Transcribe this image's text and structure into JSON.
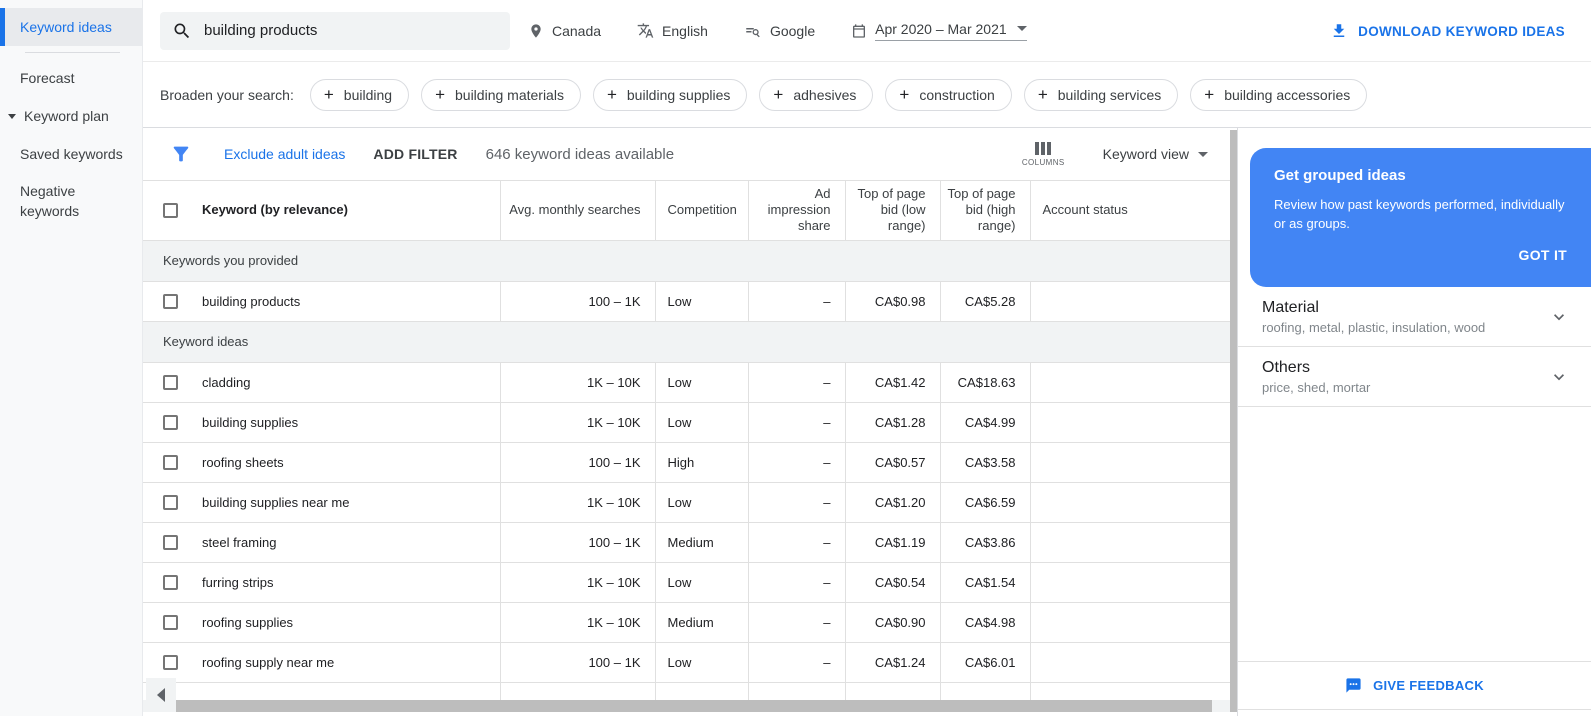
{
  "colors": {
    "accent_blue": "#1a73e8",
    "tooltip_blue": "#4285f4",
    "active_sidebar_bg": "#e8eaed",
    "section_row_bg": "#f1f3f4",
    "scrollbar_thumb": "#bdbdbd",
    "border": "#e0e0e0",
    "text_dark": "#202124",
    "text_gray": "#5f6368"
  },
  "sidebar": {
    "items": [
      {
        "label": "Keyword ideas"
      },
      {
        "label": "Forecast"
      },
      {
        "label": "Keyword plan"
      },
      {
        "label": "Saved keywords"
      },
      {
        "label": "Negative keywords"
      }
    ]
  },
  "topbar": {
    "search_value": "building products",
    "location": "Canada",
    "language": "English",
    "network": "Google",
    "date_range": "Apr 2020 – Mar 2021",
    "download_label": "DOWNLOAD KEYWORD IDEAS"
  },
  "broaden": {
    "label": "Broaden your search:",
    "chips": [
      "building",
      "building materials",
      "building supplies",
      "adhesives",
      "construction",
      "building services",
      "building accessories"
    ]
  },
  "filterbar": {
    "exclude_link": "Exclude adult ideas",
    "add_filter": "ADD FILTER",
    "count_text": "646 keyword ideas available",
    "columns_label": "COLUMNS",
    "view_label": "Keyword view"
  },
  "table": {
    "columns": [
      "Keyword (by relevance)",
      "Avg. monthly searches",
      "Competition",
      "Ad impression share",
      "Top of page bid (low range)",
      "Top of page bid (high range)",
      "Account status"
    ],
    "sections": [
      {
        "title": "Keywords you provided",
        "rows": [
          {
            "keyword": "building products",
            "searches": "100 – 1K",
            "competition": "Low",
            "ad_share": "–",
            "low_bid": "CA$0.98",
            "high_bid": "CA$5.28",
            "account_status": ""
          }
        ]
      },
      {
        "title": "Keyword ideas",
        "rows": [
          {
            "keyword": "cladding",
            "searches": "1K – 10K",
            "competition": "Low",
            "ad_share": "–",
            "low_bid": "CA$1.42",
            "high_bid": "CA$18.63",
            "account_status": ""
          },
          {
            "keyword": "building supplies",
            "searches": "1K – 10K",
            "competition": "Low",
            "ad_share": "–",
            "low_bid": "CA$1.28",
            "high_bid": "CA$4.99",
            "account_status": ""
          },
          {
            "keyword": "roofing sheets",
            "searches": "100 – 1K",
            "competition": "High",
            "ad_share": "–",
            "low_bid": "CA$0.57",
            "high_bid": "CA$3.58",
            "account_status": ""
          },
          {
            "keyword": "building supplies near me",
            "searches": "1K – 10K",
            "competition": "Low",
            "ad_share": "–",
            "low_bid": "CA$1.20",
            "high_bid": "CA$6.59",
            "account_status": ""
          },
          {
            "keyword": "steel framing",
            "searches": "100 – 1K",
            "competition": "Medium",
            "ad_share": "–",
            "low_bid": "CA$1.19",
            "high_bid": "CA$3.86",
            "account_status": ""
          },
          {
            "keyword": "furring strips",
            "searches": "1K – 10K",
            "competition": "Low",
            "ad_share": "–",
            "low_bid": "CA$0.54",
            "high_bid": "CA$1.54",
            "account_status": ""
          },
          {
            "keyword": "roofing supplies",
            "searches": "1K – 10K",
            "competition": "Medium",
            "ad_share": "–",
            "low_bid": "CA$0.90",
            "high_bid": "CA$4.98",
            "account_status": ""
          },
          {
            "keyword": "roofing supply near me",
            "searches": "100 – 1K",
            "competition": "Low",
            "ad_share": "–",
            "low_bid": "CA$1.24",
            "high_bid": "CA$6.01",
            "account_status": ""
          }
        ]
      }
    ]
  },
  "right_panel": {
    "tooltip": {
      "title": "Get grouped ideas",
      "body": "Review how past keywords performed, individually or as groups.",
      "action": "GOT IT"
    },
    "groups": [
      {
        "title": "Material",
        "subtitle": "roofing, metal, plastic, insulation, wood"
      },
      {
        "title": "Others",
        "subtitle": "price, shed, mortar"
      }
    ],
    "feedback_label": "GIVE FEEDBACK"
  }
}
